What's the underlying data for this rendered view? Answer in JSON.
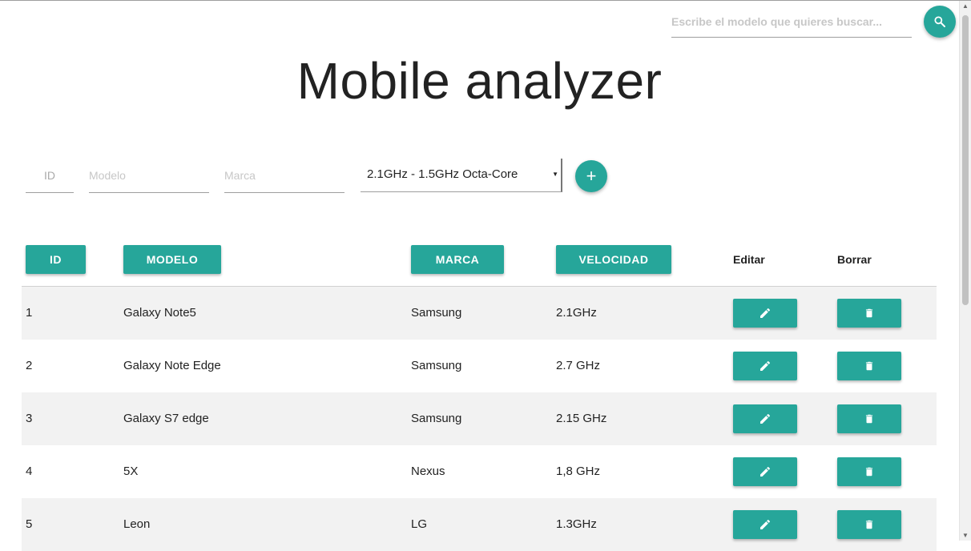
{
  "search": {
    "placeholder": "Escribe el modelo que quieres buscar...",
    "icon": "search-icon"
  },
  "title": "Mobile analyzer",
  "form": {
    "id_placeholder": "ID",
    "modelo_placeholder": "Modelo",
    "marca_placeholder": "Marca",
    "velocidad_selected": "2.1GHz - 1.5GHz Octa-Core",
    "add_label": "+"
  },
  "table": {
    "headers": {
      "id": "ID",
      "modelo": "MODELO",
      "marca": "MARCA",
      "velocidad": "VELOCIDAD",
      "editar": "Editar",
      "borrar": "Borrar"
    },
    "rows": [
      {
        "id": "1",
        "modelo": "Galaxy Note5",
        "marca": "Samsung",
        "velocidad": "2.1GHz"
      },
      {
        "id": "2",
        "modelo": "Galaxy Note Edge",
        "marca": "Samsung",
        "velocidad": "2.7 GHz"
      },
      {
        "id": "3",
        "modelo": "Galaxy S7 edge",
        "marca": "Samsung",
        "velocidad": "2.15 GHz"
      },
      {
        "id": "4",
        "modelo": "5X",
        "marca": "Nexus",
        "velocidad": "1,8 GHz"
      },
      {
        "id": "5",
        "modelo": "Leon",
        "marca": "LG",
        "velocidad": "1.3GHz"
      }
    ]
  },
  "colors": {
    "accent": "#26a69a",
    "row_alt": "#f2f2f2"
  }
}
